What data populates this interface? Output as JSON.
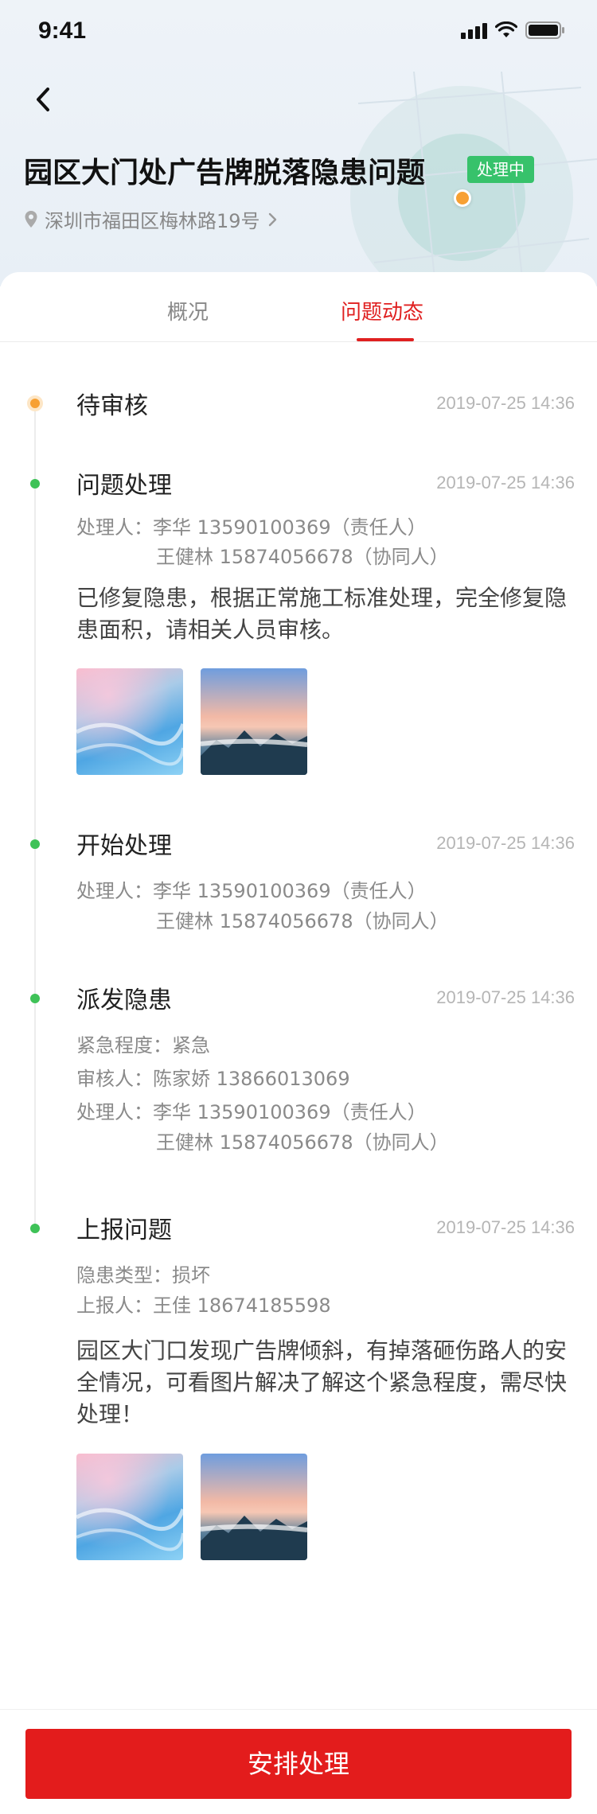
{
  "status_bar": {
    "time": "9:41"
  },
  "header": {
    "title": "园区大门处广告牌脱落隐患问题",
    "status_badge": "处理中",
    "address": "深圳市福田区梅林路19号"
  },
  "tabs": [
    {
      "label": "概况",
      "active": false
    },
    {
      "label": "问题动态",
      "active": true
    }
  ],
  "colors": {
    "accent": "#e02020",
    "badge_green": "#37c26b",
    "dot_green": "#3ec257",
    "dot_orange": "#f7a033",
    "button_red": "#e31c1c"
  },
  "timeline": [
    {
      "title": "待审核",
      "time": "2019-07-25  14:36",
      "state": "pending"
    },
    {
      "title": "问题处理",
      "time": "2019-07-25  14:36",
      "lines": [
        "处理人：李华  13590100369（责任人）",
        "王健林 15874056678（协同人）"
      ],
      "desc": "已修复隐患，根据正常施工标准处理，完全修复隐患面积，请相关人员审核。",
      "images": [
        "sea-photo",
        "mountain-photo"
      ]
    },
    {
      "title": "开始处理",
      "time": "2019-07-25  14:36",
      "lines": [
        "处理人：李华  13590100369（责任人）",
        "王健林 15874056678（协同人）"
      ]
    },
    {
      "title": "派发隐患",
      "time": "2019-07-25  14:36",
      "lines": [
        "紧急程度：紧急",
        "审核人：陈家娇  13866013069",
        "处理人：李华  13590100369（责任人）",
        "王健林 15874056678（协同人）"
      ]
    },
    {
      "title": "上报问题",
      "time": "2019-07-25  14:36",
      "lines": [
        "隐患类型：损坏",
        "上报人：王佳  18674185598"
      ],
      "desc": "园区大门口发现广告牌倾斜，有掉落砸伤路人的安全情况，可看图片解决了解这个紧急程度，需尽快处理！",
      "images": [
        "sea-photo",
        "mountain-photo"
      ]
    }
  ],
  "footer": {
    "action_label": "安排处理"
  }
}
